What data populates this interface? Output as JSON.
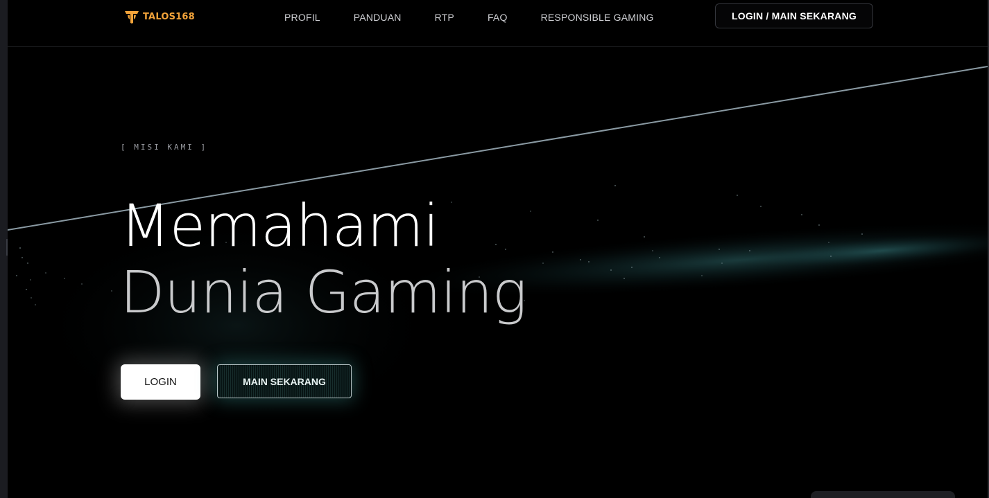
{
  "brand": {
    "name": "TALOS168",
    "logo_icon": "talos-logo-icon",
    "accent_color": "#f2a33a"
  },
  "nav": {
    "links": [
      "PROFIL",
      "PANDUAN",
      "RTP",
      "FAQ",
      "RESPONSIBLE GAMING"
    ],
    "cta_label": "LOGIN / MAIN SEKARANG"
  },
  "hero": {
    "label": "[ MISI KAMI ]",
    "title_line1": "Memahami",
    "title_line2": "Dunia Gaming",
    "login_label": "LOGIN",
    "play_label": "MAIN SEKARANG",
    "glow_color": "#46aaa5"
  }
}
